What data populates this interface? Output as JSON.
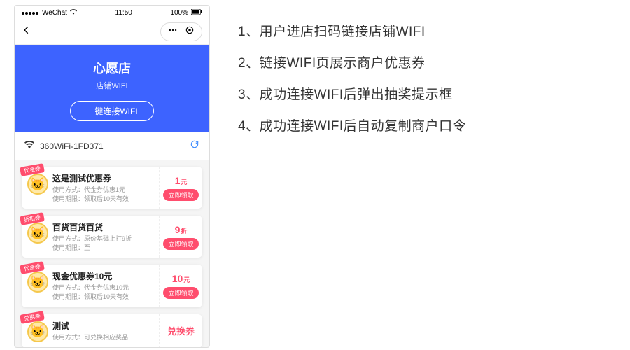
{
  "status": {
    "carrier": "WeChat",
    "time": "11:50",
    "battery": "100%"
  },
  "hero": {
    "shop_name": "心愿店",
    "shop_sub": "店铺WIFI",
    "connect_label": "一键连接WIFI"
  },
  "wifi": {
    "ssid": "360WiFi-1FD371"
  },
  "coupons": [
    {
      "badge": "代金券",
      "title": "这是测试优惠券",
      "sub1": "使用方式：代金券优惠1元",
      "sub2": "使用期限：领取后10天有效",
      "value": "1",
      "unit": "元",
      "btn": "立即领取"
    },
    {
      "badge": "折扣券",
      "title": "百货百货百货",
      "sub1": "使用方式：原价基础上打9折",
      "sub2": "使用期限：至",
      "value": "9",
      "unit": "折",
      "btn": "立即领取"
    },
    {
      "badge": "代金券",
      "title": "现金优惠券10元",
      "sub1": "使用方式：代金券优惠10元",
      "sub2": "使用期限：领取后10天有效",
      "value": "10",
      "unit": "元",
      "btn": "立即领取"
    },
    {
      "badge": "兑换券",
      "title": "测试",
      "sub1": "使用方式：可兑换相应奖品",
      "sub2": "",
      "value": "兑换券",
      "unit": "",
      "btn": ""
    }
  ],
  "instructions": [
    "1、用户进店扫码链接店铺WIFI",
    "2、链接WIFI页展示商户优惠券",
    "3、成功连接WIFI后弹出抽奖提示框",
    "4、成功连接WIFI后自动复制商户口令"
  ]
}
